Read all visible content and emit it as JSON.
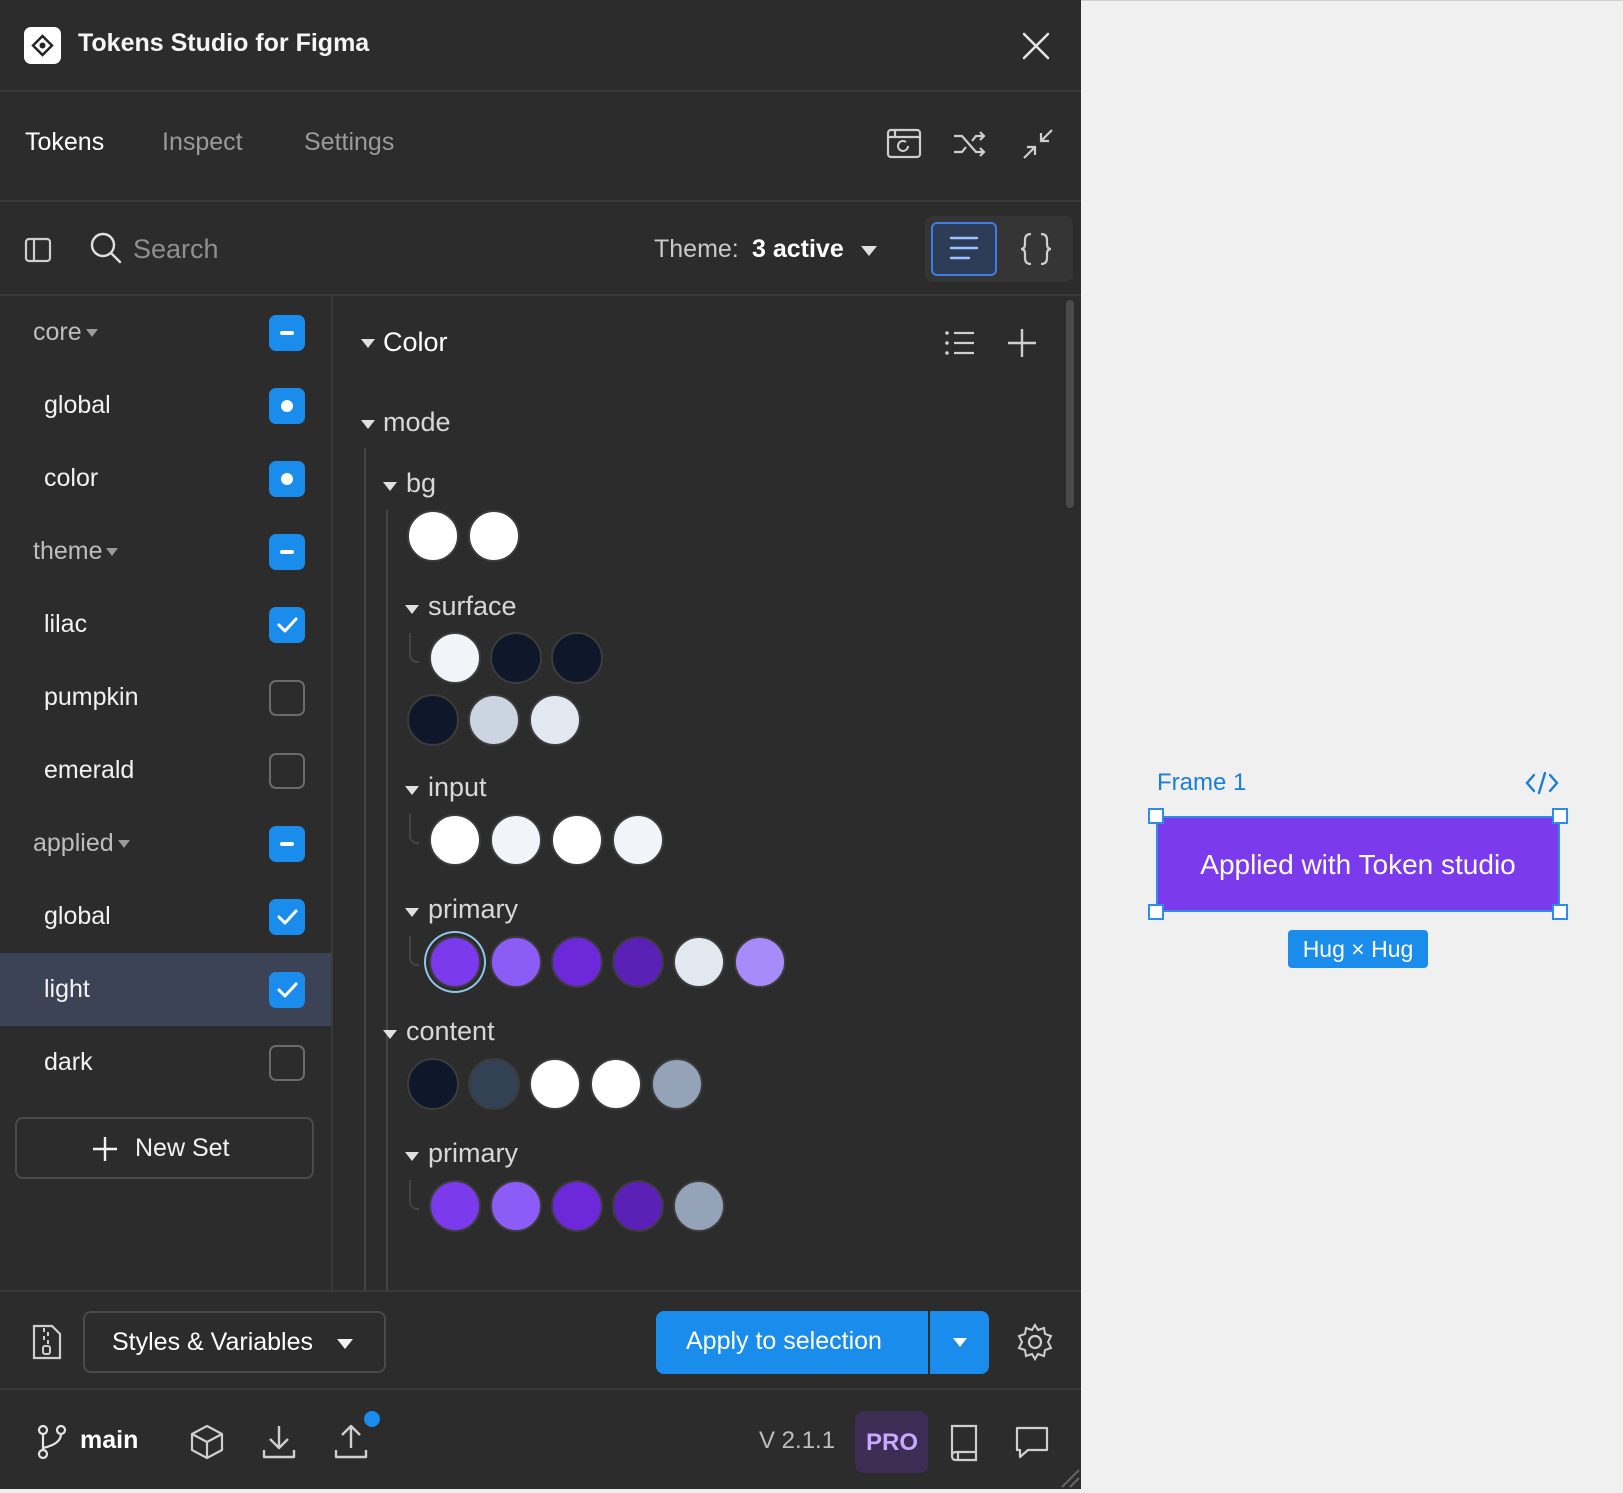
{
  "app": {
    "title": "Tokens Studio for Figma"
  },
  "tabs": [
    {
      "label": "Tokens",
      "active": true
    },
    {
      "label": "Inspect",
      "active": false
    },
    {
      "label": "Settings",
      "active": false
    }
  ],
  "search": {
    "placeholder": "Search"
  },
  "theme": {
    "label": "Theme:",
    "value": "3 active"
  },
  "sets": [
    {
      "label": "core",
      "group": true,
      "state": "partial"
    },
    {
      "label": "global",
      "group": false,
      "state": "source"
    },
    {
      "label": "color",
      "group": false,
      "state": "source"
    },
    {
      "label": "theme",
      "group": true,
      "state": "partial"
    },
    {
      "label": "lilac",
      "group": false,
      "state": "checked"
    },
    {
      "label": "pumpkin",
      "group": false,
      "state": "unchecked"
    },
    {
      "label": "emerald",
      "group": false,
      "state": "unchecked"
    },
    {
      "label": "applied",
      "group": true,
      "state": "partial"
    },
    {
      "label": "global",
      "group": false,
      "state": "checked"
    },
    {
      "label": "light",
      "group": false,
      "state": "checked",
      "selected": true
    },
    {
      "label": "dark",
      "group": false,
      "state": "unchecked"
    }
  ],
  "new_set_label": "New Set",
  "token_tree": {
    "category": "Color",
    "mode_label": "mode",
    "groups": {
      "bg": {
        "label": "bg",
        "swatches": [
          "#ffffff",
          "#ffffff"
        ]
      },
      "surface": {
        "label": "surface",
        "swatches": [
          "#f1f5f9",
          "#0f172a",
          "#0f172a",
          "#0f172a",
          "#cbd5e1",
          "#e2e8f0"
        ]
      },
      "input": {
        "label": "input",
        "swatches": [
          "#ffffff",
          "#f1f5f9",
          "#ffffff",
          "#f1f5f9"
        ]
      },
      "bg_primary": {
        "label": "primary",
        "swatches": [
          "#7c3aed",
          "#8b5cf6",
          "#6d28d9",
          "#5b21b6",
          "#e2e8f0",
          "#a78bfa"
        ]
      },
      "content": {
        "label": "content",
        "swatches": [
          "#0f172a",
          "#334155",
          "#ffffff",
          "#ffffff",
          "#94a3b8"
        ]
      },
      "content_primary": {
        "label": "primary",
        "swatches": [
          "#7c3aed",
          "#8b5cf6",
          "#6d28d9",
          "#5b21b6",
          "#94a3b8"
        ]
      }
    }
  },
  "footer": {
    "styles_select": "Styles & Variables",
    "apply_button": "Apply to selection"
  },
  "bottom": {
    "branch": "main",
    "version": "V 2.1.1",
    "pro": "PRO"
  },
  "canvas": {
    "frame_label": "Frame 1",
    "button_text": "Applied with Token studio",
    "size_badge": "Hug × Hug"
  },
  "colors": {
    "accent": "#1a8ceb",
    "panel_bg": "#2c2c2c",
    "frame_fill": "#7c3aed"
  }
}
